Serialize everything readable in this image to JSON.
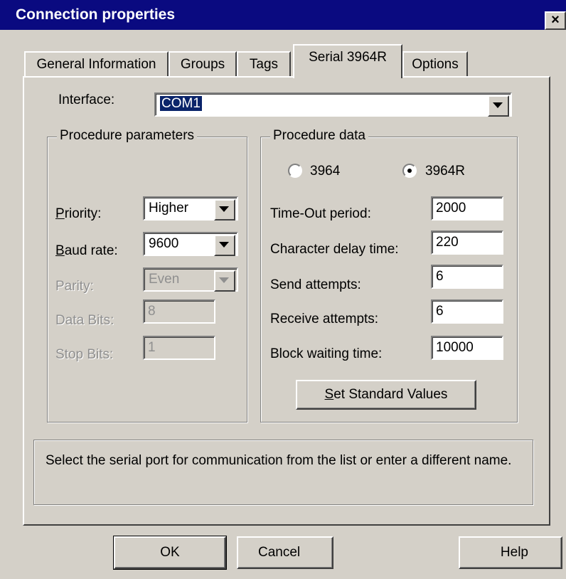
{
  "window": {
    "title": "Connection properties",
    "close_glyph": "×"
  },
  "tabs": [
    {
      "label": "General Information"
    },
    {
      "label": "Groups"
    },
    {
      "label": "Tags"
    },
    {
      "label": "Serial 3964R"
    },
    {
      "label": "Options"
    }
  ],
  "interface": {
    "label": "Interface:",
    "value": "COM1"
  },
  "procedure_parameters": {
    "legend": "Procedure parameters",
    "priority": {
      "label_pre": "",
      "label_u": "P",
      "label_post": "riority:",
      "value": "Higher"
    },
    "baud_rate": {
      "label_pre": "",
      "label_u": "B",
      "label_post": "aud rate:",
      "value": "9600"
    },
    "parity": {
      "label": "Parity:",
      "value": "Even"
    },
    "data_bits": {
      "label": "Data Bits:",
      "value": "8"
    },
    "stop_bits": {
      "label": "Stop Bits:",
      "value": "1"
    }
  },
  "procedure_data": {
    "legend": "Procedure data",
    "radio_3964": {
      "label": "3964",
      "selected": false
    },
    "radio_3964r": {
      "label": "3964R",
      "selected": true
    },
    "timeout": {
      "label": "Time-Out period:",
      "value": "2000"
    },
    "char_delay": {
      "label": "Character delay time:",
      "value": "220"
    },
    "send_attempts": {
      "label": "Send attempts:",
      "value": "6"
    },
    "receive_attempts": {
      "label": "Receive attempts:",
      "value": "6"
    },
    "block_wait": {
      "label": "Block waiting time:",
      "value": "10000"
    },
    "set_standard": {
      "label_u": "S",
      "label_post": "et Standard Values"
    }
  },
  "hint": "Select the serial port for communication from the list or enter a different name.",
  "buttons": {
    "ok": "OK",
    "cancel": "Cancel",
    "help": "Help"
  }
}
